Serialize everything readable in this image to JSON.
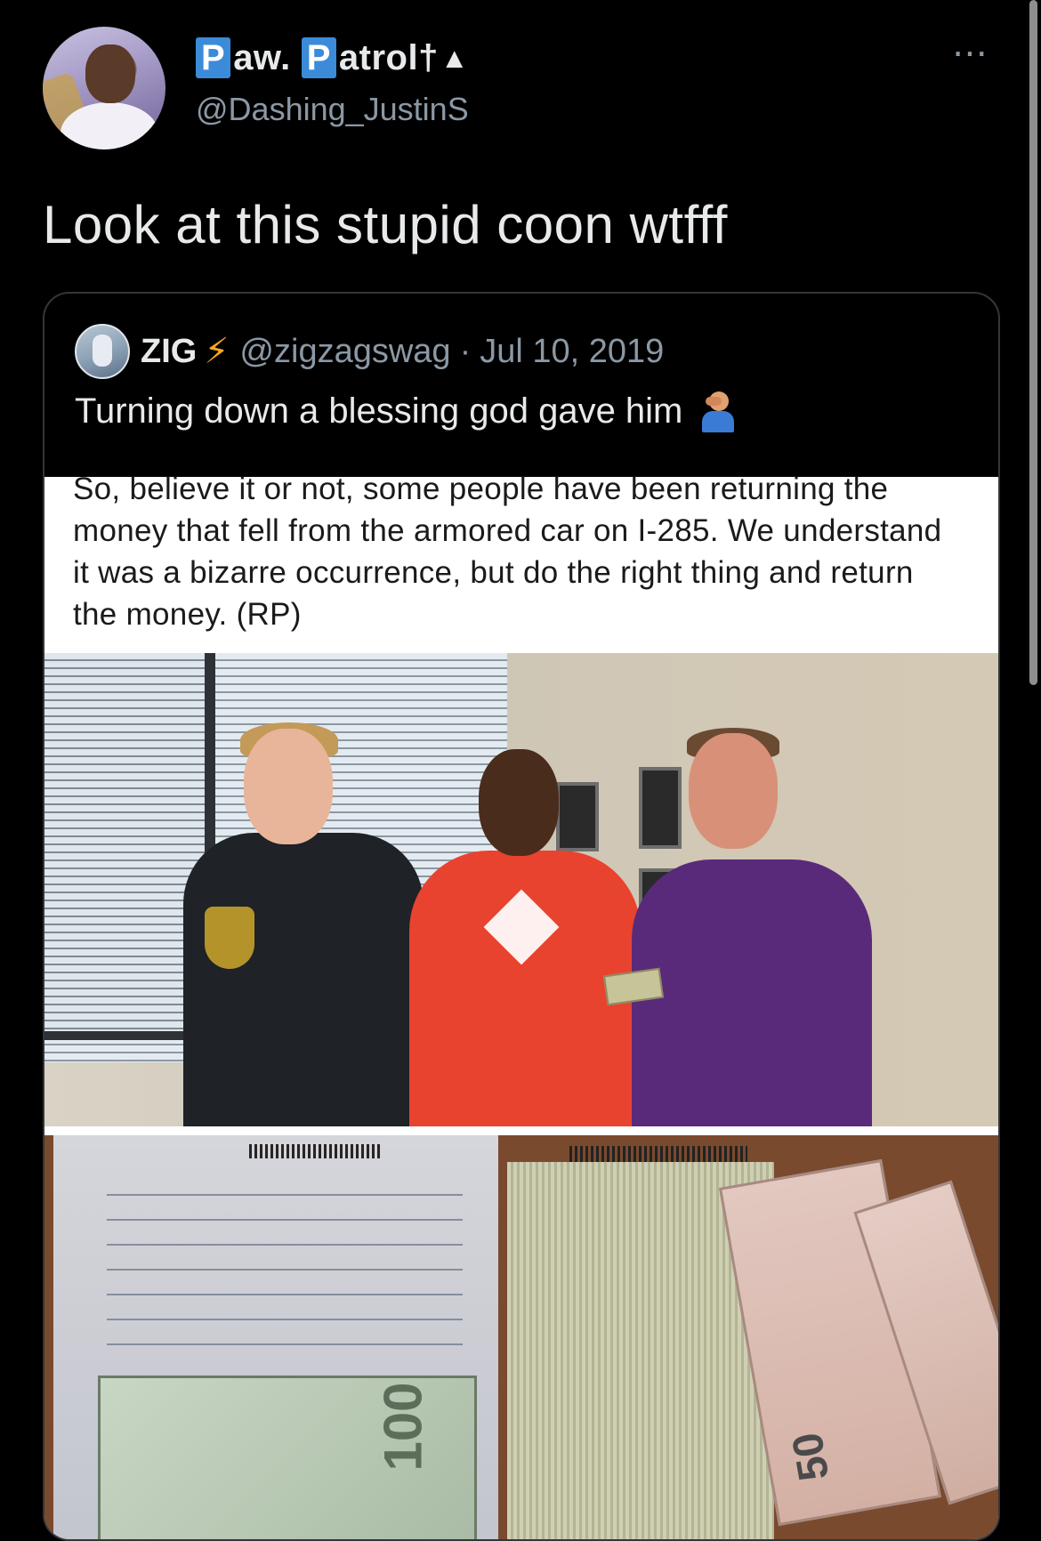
{
  "tweet": {
    "display_name_parts": [
      "P",
      "aw.",
      "P",
      "atrol",
      "†",
      "▲"
    ],
    "handle": "@Dashing_JustinS",
    "more_icon": "⋯",
    "text": "Look at this stupid coon wtfff"
  },
  "quote": {
    "display_name": "ZIG",
    "bolt_icon": "⚡",
    "handle": "@zigzagswag",
    "separator": "·",
    "date": "Jul 10, 2019",
    "text": "Turning down a blessing god gave him",
    "emoji": "facepalm-icon",
    "image_text": "So, believe it or not, some people have been returning the money that fell from the armored car on I-285. We understand it was a bizarre occurrence, but do the right thing and return the money. (RP)",
    "bill_100": "100",
    "bill_50": "50"
  },
  "colors": {
    "background": "#000000",
    "text_primary": "#e7e9ea",
    "text_secondary": "#8b98a5",
    "name_box": "#3b8bd9",
    "bolt": "#f5a623",
    "border": "#333639"
  }
}
